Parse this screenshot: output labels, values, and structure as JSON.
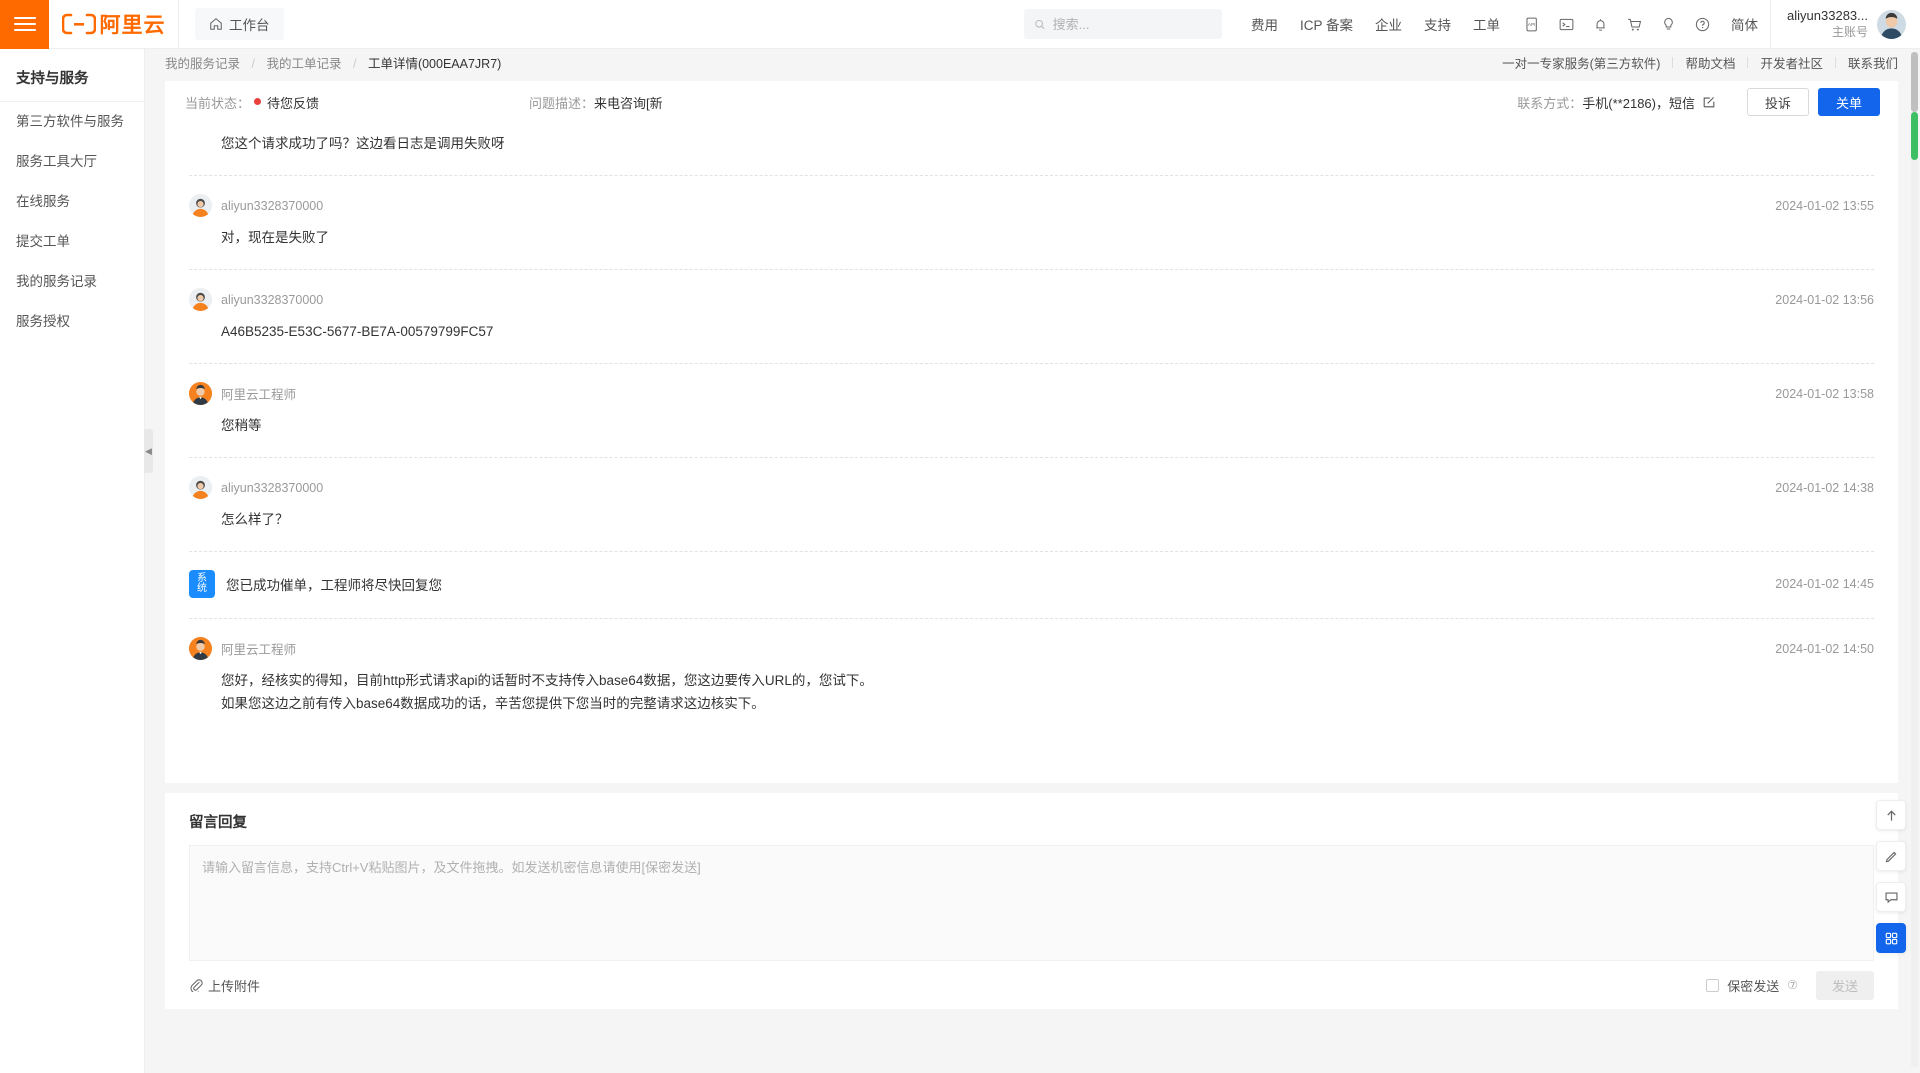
{
  "header": {
    "workbench": "工作台",
    "logo_text": "阿里云",
    "search_placeholder": "搜索...",
    "nav": [
      {
        "label": "费用"
      },
      {
        "label": "ICP 备案"
      },
      {
        "label": "企业"
      },
      {
        "label": "支持"
      },
      {
        "label": "工单"
      }
    ],
    "icons": [
      "api-icon",
      "console-terminal-icon",
      "bell-icon",
      "cart-icon",
      "lightbulb-icon",
      "help-circle-icon"
    ],
    "language": "简体",
    "user_name": "aliyun33283...",
    "user_role": "主账号"
  },
  "sidebar": {
    "title": "支持与服务",
    "items": [
      {
        "label": "第三方软件与服务"
      },
      {
        "label": "服务工具大厅"
      },
      {
        "label": "在线服务"
      },
      {
        "label": "提交工单"
      },
      {
        "label": "我的服务记录"
      },
      {
        "label": "服务授权"
      }
    ]
  },
  "breadcrumb": {
    "items": [
      {
        "label": "我的服务记录"
      },
      {
        "label": "我的工单记录"
      }
    ],
    "current": "工单详情(000EAA7JR7)"
  },
  "right_links": [
    {
      "label": "一对一专家服务(第三方软件)"
    },
    {
      "label": "帮助文档"
    },
    {
      "label": "开发者社区"
    },
    {
      "label": "联系我们"
    }
  ],
  "status_bar": {
    "status_label": "当前状态：",
    "status_value": "待您反馈",
    "status_color": "#e8403a",
    "desc_label": "问题描述：",
    "desc_value": "来电咨询[新",
    "contact_label": "联系方式：",
    "contact_value": "手机(**2186)，短信",
    "complain_button": "投诉",
    "close_button": "关单"
  },
  "messages": [
    {
      "type": "user",
      "author": "",
      "time": "",
      "text": "您这个请求成功了吗？这边看日志是调用失败呀",
      "partial": true
    },
    {
      "type": "user",
      "author": "aliyun3328370000",
      "time": "2024-01-02 13:55",
      "text": "对，现在是失败了",
      "partial": false
    },
    {
      "type": "user",
      "author": "aliyun3328370000",
      "time": "2024-01-02 13:56",
      "text": "A46B5235-E53C-5677-BE7A-00579799FC57",
      "partial": false
    },
    {
      "type": "engineer",
      "author": "阿里云工程师",
      "time": "2024-01-02 13:58",
      "text": "您稍等",
      "partial": false
    },
    {
      "type": "user",
      "author": "aliyun3328370000",
      "time": "2024-01-02 14:38",
      "text": "怎么样了？",
      "partial": false
    },
    {
      "type": "system",
      "badge": "系统",
      "time": "2024-01-02 14:45",
      "text": "您已成功催单，工程师将尽快回复您",
      "partial": false
    },
    {
      "type": "engineer",
      "author": "阿里云工程师",
      "time": "2024-01-02 14:50",
      "text": "您好，经核实的得知，目前http形式请求api的话暂时不支持传入base64数据，您这边要传入URL的，您试下。",
      "text2": "如果您这边之前有传入base64数据成功的话，辛苦您提供下您当时的完整请求这边核实下。",
      "partial": false
    }
  ],
  "reply": {
    "title": "留言回复",
    "placeholder": "请输入留言信息，支持Ctrl+V粘贴图片，及文件拖拽。如发送机密信息请使用[保密发送]",
    "value": "",
    "upload_label": "上传附件",
    "secret_label": "保密发送",
    "send_label": "发送"
  },
  "float_actions": [
    {
      "name": "back-to-top-icon"
    },
    {
      "name": "feedback-edit-icon"
    },
    {
      "name": "chat-bubble-icon"
    },
    {
      "name": "apps-grid-icon"
    }
  ],
  "colors": {
    "brand_orange": "#ff6a00",
    "primary_blue": "#1366ec",
    "status_red": "#e8403a"
  }
}
